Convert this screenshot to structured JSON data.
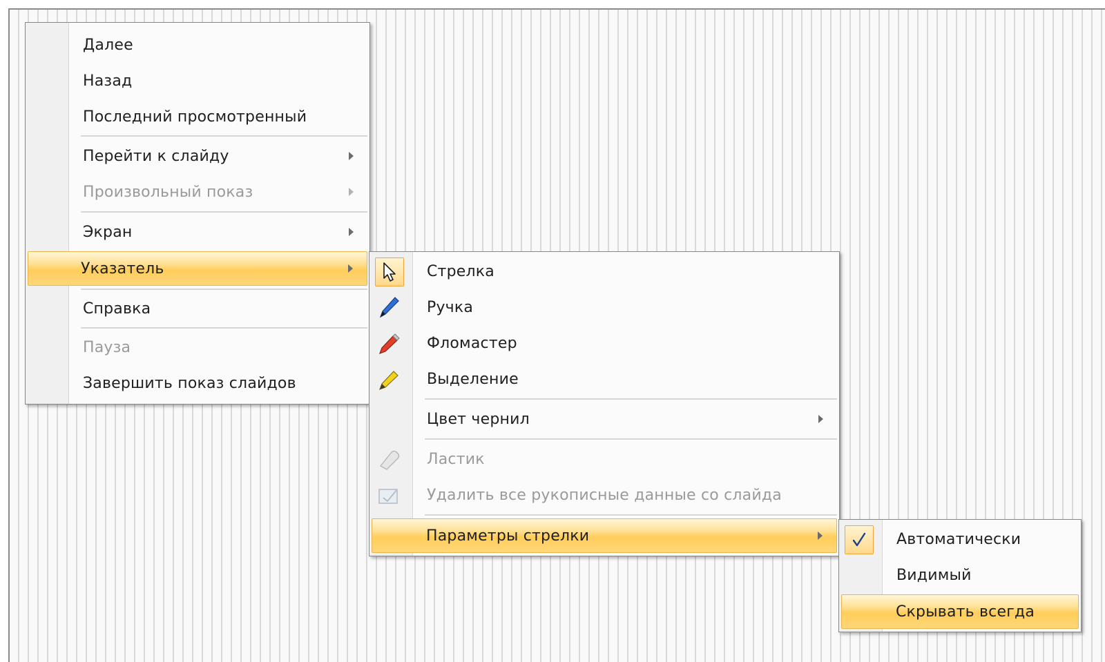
{
  "main_menu": {
    "items": [
      {
        "label": "Далее"
      },
      {
        "label": "Назад"
      },
      {
        "label": "Последний просмотренный"
      },
      {
        "label": "Перейти к слайду"
      },
      {
        "label": "Произвольный показ"
      },
      {
        "label": "Экран"
      },
      {
        "label": "Указатель"
      },
      {
        "label": "Справка"
      },
      {
        "label": "Пауза"
      },
      {
        "label": "Завершить показ слайдов"
      }
    ]
  },
  "pointer_menu": {
    "items": [
      {
        "label": "Стрелка",
        "icon": "arrow-cursor-icon"
      },
      {
        "label": "Ручка",
        "icon": "pen-icon"
      },
      {
        "label": "Фломастер",
        "icon": "felt-tip-pen-icon"
      },
      {
        "label": "Выделение",
        "icon": "highlighter-icon"
      },
      {
        "label": "Цвет чернил"
      },
      {
        "label": "Ластик",
        "icon": "eraser-icon"
      },
      {
        "label": "Удалить все рукописные данные со слайда",
        "icon": "erase-all-icon"
      },
      {
        "label": "Параметры стрелки"
      }
    ]
  },
  "arrow_options_menu": {
    "items": [
      {
        "label": "Автоматически",
        "icon": "checkmark-icon"
      },
      {
        "label": "Видимый"
      },
      {
        "label": "Скрывать всегда"
      }
    ]
  },
  "colors": {
    "highlight": "#ffcd5a",
    "highlight_border": "#e8b64b",
    "disabled_text": "#9a9a9a"
  }
}
